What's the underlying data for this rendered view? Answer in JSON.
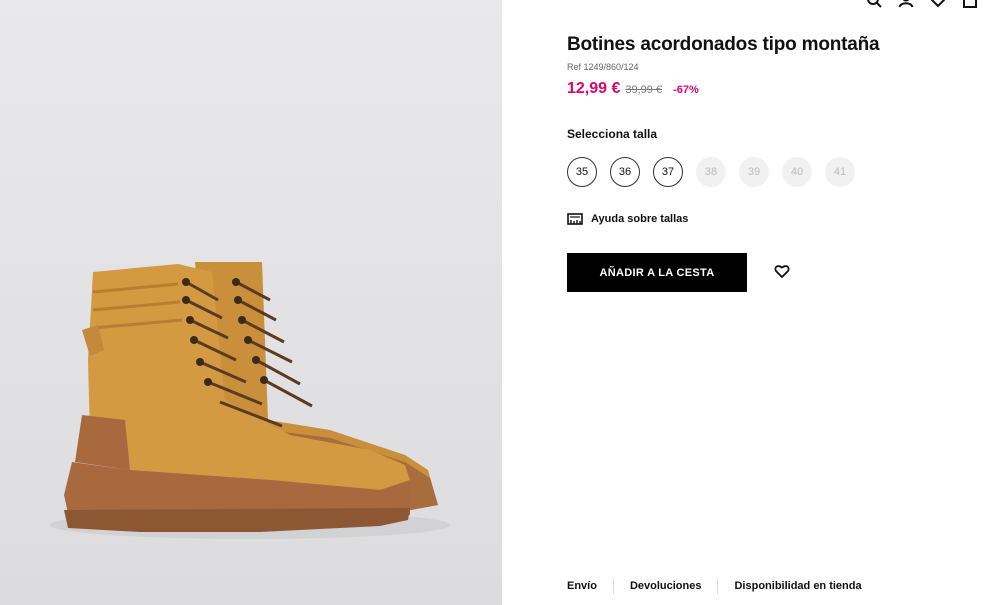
{
  "product": {
    "title": "Botines acordonados tipo montaña",
    "ref": "Ref 1249/860/124",
    "price_now": "12,99 €",
    "price_old": "39,99 €",
    "discount": "-67%"
  },
  "sizes": {
    "label": "Selecciona talla",
    "options": [
      {
        "label": "35",
        "available": true
      },
      {
        "label": "36",
        "available": true
      },
      {
        "label": "37",
        "available": true
      },
      {
        "label": "38",
        "available": false
      },
      {
        "label": "39",
        "available": false
      },
      {
        "label": "40",
        "available": false
      },
      {
        "label": "41",
        "available": false
      }
    ]
  },
  "help": {
    "label": "Ayuda sobre tallas",
    "icon": "ruler-icon"
  },
  "actions": {
    "add_to_cart": "AÑADIR A LA CESTA",
    "favorite_icon": "heart-icon"
  },
  "footer": {
    "links": [
      "Envío",
      "Devoluciones",
      "Disponibilidad en tienda"
    ]
  },
  "colors": {
    "accent_price": "#e5006f",
    "button_bg": "#000000"
  }
}
